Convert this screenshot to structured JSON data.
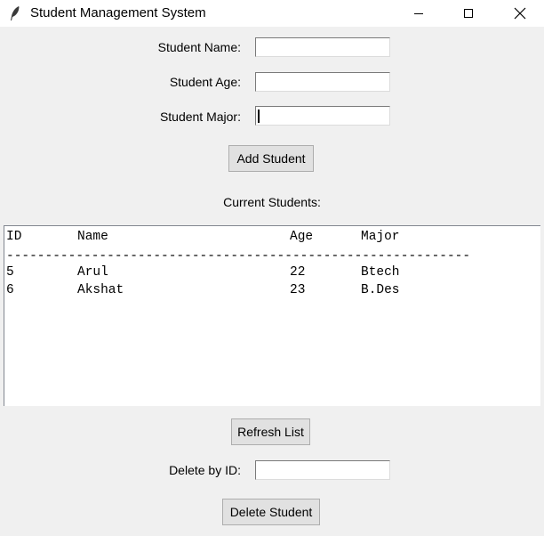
{
  "window": {
    "title": "Student Management System",
    "icon": "feather-icon"
  },
  "form": {
    "name_label": "Student Name:",
    "age_label": "Student Age:",
    "major_label": "Student Major:",
    "name_value": "",
    "age_value": "",
    "major_value": ""
  },
  "buttons": {
    "add": "Add Student",
    "refresh": "Refresh List",
    "delete": "Delete Student"
  },
  "list": {
    "title": "Current Students:",
    "columns": [
      "ID",
      "Name",
      "Age",
      "Major"
    ],
    "separator": "------------------------------------------------------------",
    "rows": [
      {
        "id": "5",
        "name": "Arul",
        "age": "22",
        "major": "Btech"
      },
      {
        "id": "6",
        "name": "Akshat",
        "age": "23",
        "major": "B.Des"
      }
    ]
  },
  "delete": {
    "label": "Delete by ID:",
    "value": ""
  }
}
